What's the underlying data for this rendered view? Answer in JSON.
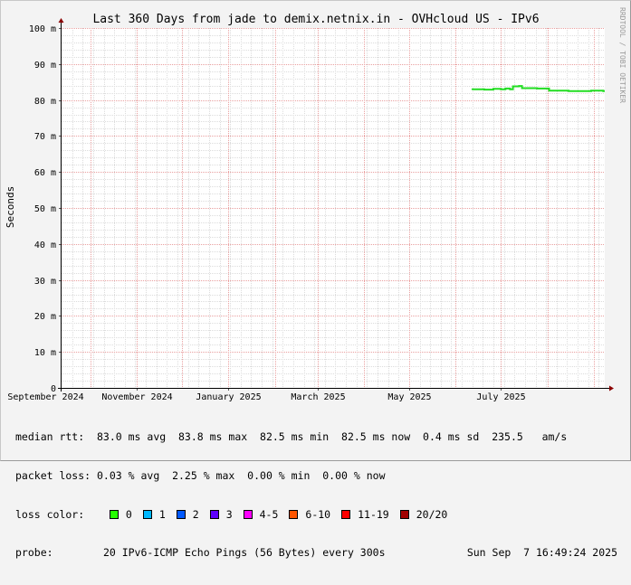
{
  "chart_data": {
    "type": "line",
    "title": "Last 360 Days from jade to demix.netnix.in - OVHcloud US - IPv6",
    "ylabel": "Seconds",
    "watermark": "RRDTOOL / TOBI OETIKER",
    "ylim": [
      0,
      100
    ],
    "yticks": [
      0,
      10,
      20,
      30,
      40,
      50,
      60,
      70,
      80,
      90,
      100
    ],
    "yticklabels": [
      "0",
      "10 m",
      "20 m",
      "30 m",
      "40 m",
      "50 m",
      "60 m",
      "70 m",
      "80 m",
      "90 m",
      "100 m"
    ],
    "xlim": [
      "2024-09-12",
      "2025-09-07"
    ],
    "xticks": [
      "2024-09-01",
      "2024-11-01",
      "2025-01-01",
      "2025-03-01",
      "2025-05-01",
      "2025-07-01"
    ],
    "xticklabels": [
      "September 2024",
      "November 2024",
      "January 2025",
      "March 2025",
      "May 2025",
      "July 2025"
    ],
    "grid": true,
    "series": [
      {
        "color": "#22dd22",
        "points": [
          [
            "2025-06-12",
            83.0
          ],
          [
            "2025-06-20",
            82.9
          ],
          [
            "2025-06-26",
            83.1
          ],
          [
            "2025-07-01",
            83.0
          ],
          [
            "2025-07-04",
            83.2
          ],
          [
            "2025-07-07",
            83.0
          ],
          [
            "2025-07-09",
            83.8
          ],
          [
            "2025-07-13",
            83.9
          ],
          [
            "2025-07-15",
            83.3
          ],
          [
            "2025-07-25",
            83.2
          ],
          [
            "2025-08-01",
            83.2
          ],
          [
            "2025-08-02",
            82.6
          ],
          [
            "2025-08-15",
            82.5
          ],
          [
            "2025-08-30",
            82.6
          ],
          [
            "2025-09-07",
            82.5
          ]
        ]
      }
    ]
  },
  "legend": {
    "median_line": "median rtt:  83.0 ms avg  83.8 ms max  82.5 ms min  82.5 ms now  0.4 ms sd  235.5   am/s",
    "loss_line": "packet loss: 0.03 % avg  2.25 % max  0.00 % min  0.00 % now",
    "loss_color_label": "loss color:",
    "loss_colors": [
      {
        "label": "0",
        "color": "#26ff00"
      },
      {
        "label": "1",
        "color": "#00b8ff"
      },
      {
        "label": "2",
        "color": "#0059ff"
      },
      {
        "label": "3",
        "color": "#5e00ff"
      },
      {
        "label": "4-5",
        "color": "#ff00ff"
      },
      {
        "label": "6-10",
        "color": "#ff5500"
      },
      {
        "label": "11-19",
        "color": "#ff0000"
      },
      {
        "label": "20/20",
        "color": "#a10000"
      }
    ],
    "probe_label": "probe:",
    "probe_text": "20 IPv6-ICMP Echo Pings (56 Bytes) every 300s",
    "date": "Sun Sep  7 16:49:24 2025"
  }
}
